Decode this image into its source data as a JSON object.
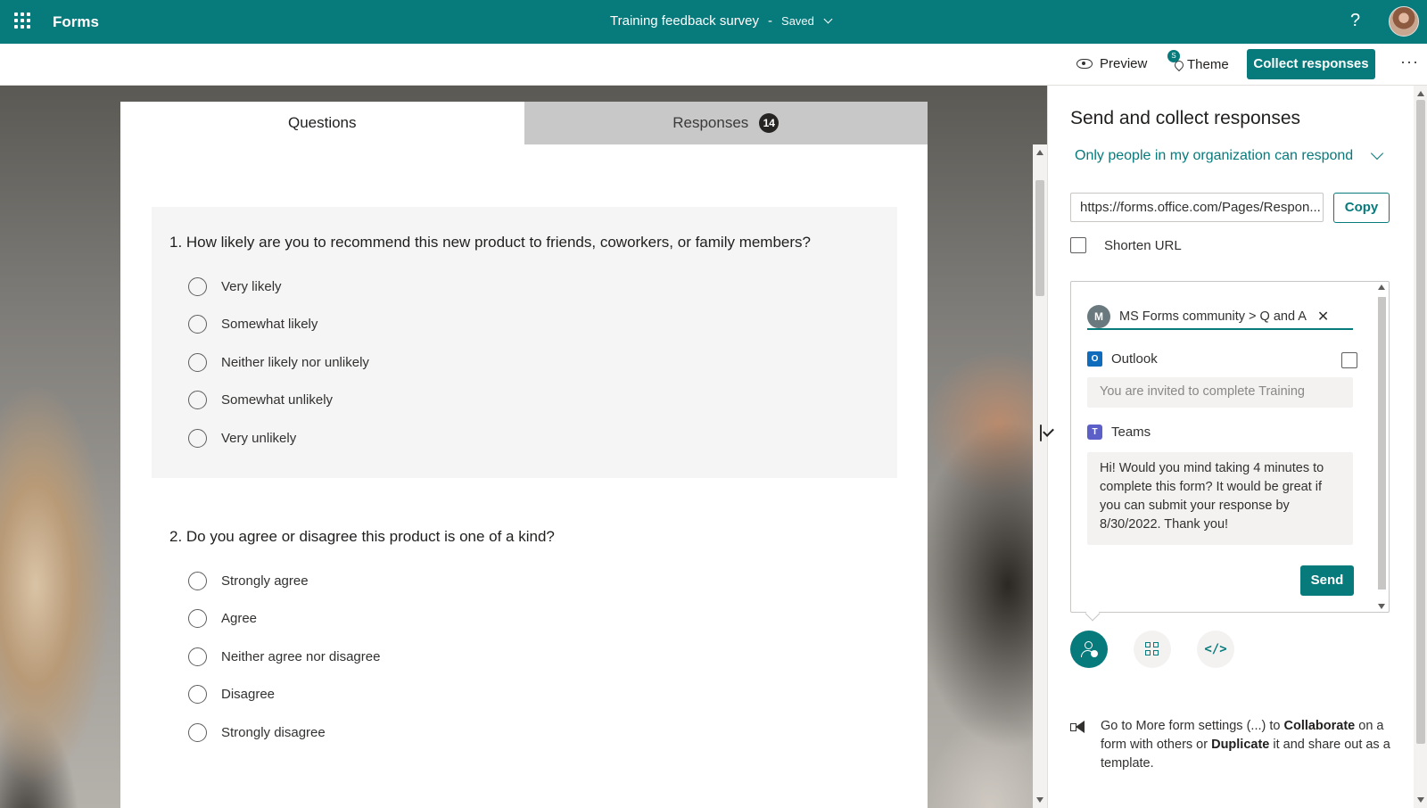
{
  "app": {
    "name": "Forms",
    "title": "Training feedback survey",
    "status": "Saved",
    "help": "?"
  },
  "toolbar": {
    "preview": "Preview",
    "theme": "Theme",
    "theme_badge": "S",
    "collect": "Collect responses",
    "more": "···"
  },
  "tabs": {
    "questions": "Questions",
    "responses": "Responses",
    "responses_count": "14"
  },
  "questions": [
    {
      "title": "1. How likely are you to recommend this new product to friends, coworkers, or family members?",
      "options": [
        "Very likely",
        "Somewhat likely",
        "Neither likely nor unlikely",
        "Somewhat unlikely",
        "Very unlikely"
      ]
    },
    {
      "title": "2. Do you agree or disagree this product is one of a kind?",
      "options": [
        "Strongly agree",
        "Agree",
        "Neither agree nor disagree",
        "Disagree",
        "Strongly disagree"
      ]
    }
  ],
  "panel": {
    "title": "Send and collect responses",
    "permission": "Only people in my organization can respond",
    "url": "https://forms.office.com/Pages/Respon...",
    "copy": "Copy",
    "shorten_url": "Shorten URL",
    "shorten_checked": false,
    "recipient": {
      "initial": "M",
      "name": "MS Forms community > Q and A",
      "remove": "✕"
    },
    "outlook": {
      "label": "Outlook",
      "checked": false,
      "placeholder": "You are invited to complete Training"
    },
    "teams": {
      "label": "Teams",
      "checked": true,
      "message": "Hi! Would you mind taking 4 minutes to complete this form? It would be great if you can submit your response by 8/30/2022. Thank you!"
    },
    "send": "Send",
    "tip": {
      "part1": "Go to More form settings (...) to ",
      "bold1": "Collaborate",
      "part2": " on a form with others or ",
      "bold2": "Duplicate",
      "part3": " it and share out as a template."
    }
  },
  "colors": {
    "brand": "#077a7c",
    "badge": "#252423"
  },
  "icons": [
    "app-launcher-icon",
    "help-icon",
    "eye-icon",
    "theme-icon",
    "more-icon",
    "chevron-down-icon",
    "outlook-icon",
    "teams-icon",
    "share-people-icon",
    "qr-code-icon",
    "embed-code-icon",
    "megaphone-icon"
  ]
}
